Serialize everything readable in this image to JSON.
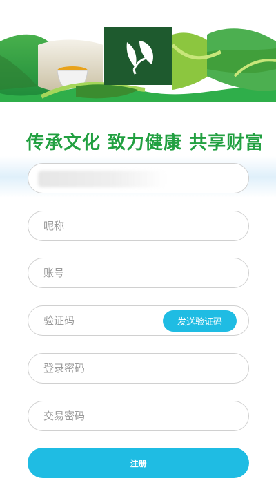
{
  "banner": {
    "logo_icon": "tea-leaf-icon",
    "colors": {
      "dark_green": "#1e5a2e",
      "green": "#22a041",
      "light_green": "#8cc63f"
    }
  },
  "slogan": "传承文化 致力健康 共享财富",
  "form": {
    "referrer": {
      "value": ""
    },
    "nickname": {
      "placeholder": "昵称"
    },
    "account": {
      "placeholder": "账号"
    },
    "code": {
      "placeholder": "验证码",
      "send_label": "发送验证码"
    },
    "login_password": {
      "placeholder": "登录密码"
    },
    "trade_password": {
      "placeholder": "交易密码"
    },
    "submit_label": "注册"
  },
  "accent_color": "#1fbce3"
}
